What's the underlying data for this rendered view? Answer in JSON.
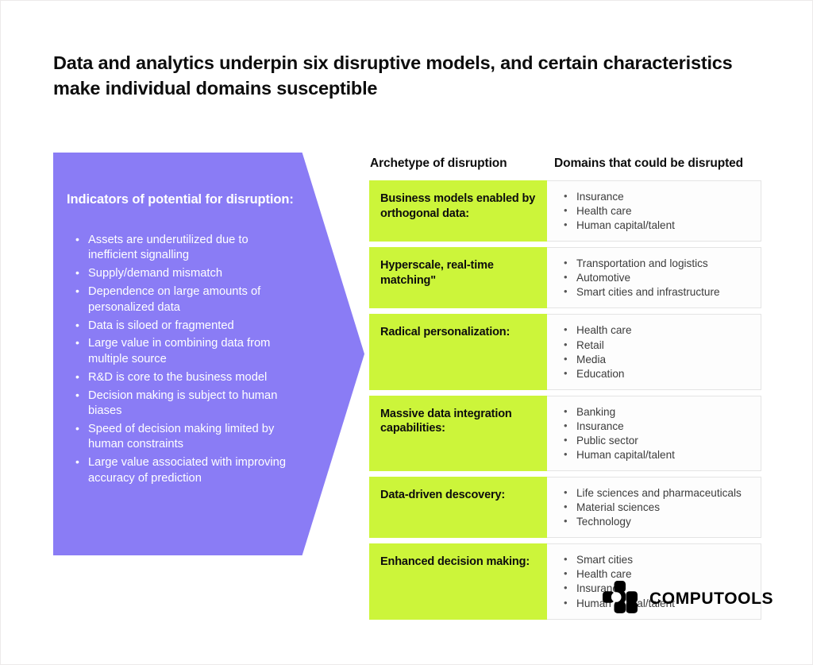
{
  "slide": {
    "title": "Data and analytics underpin six disruptive models, and certain characteristics make individual domains susceptible",
    "colors": {
      "purple": "#8a7cf5",
      "green": "#ccf53a",
      "text_dark": "#0d0d0d",
      "text_gray": "#3c3c3c",
      "cell_bg": "#fdfdfd",
      "cell_border": "#e4e4e4"
    }
  },
  "arrow_panel": {
    "heading": "Indicators of potential for disruption:",
    "bullets": [
      "Assets are underutilized due to inefficient signalling",
      "Supply/demand mismatch",
      "Dependence on large amounts of personalized data",
      "Data is siloed or fragmented",
      "Large value in combining data from multiple source",
      "R&D is core to the business model",
      "Decision making is subject to human biases",
      "Speed of decision making limited by human constraints",
      "Large value associated with improving accuracy of prediction"
    ]
  },
  "table": {
    "headers": {
      "archetype": "Archetype of disruption",
      "domains": "Domains that could be disrupted"
    },
    "rows": [
      {
        "archetype": "Business models enabled by orthogonal data:",
        "domains": [
          "Insurance",
          "Health care",
          "Human capital/talent"
        ]
      },
      {
        "archetype": "Hyperscale, real-time matching\"",
        "domains": [
          "Transportation and logistics",
          "Automotive",
          "Smart cities and infrastructure"
        ]
      },
      {
        "archetype": "Radical personalization:",
        "domains": [
          "Health care",
          "Retail",
          "Media",
          "Education"
        ]
      },
      {
        "archetype": "Massive data integration capabilities:",
        "domains": [
          "Banking",
          "Insurance",
          "Public sector",
          "Human capital/talent"
        ]
      },
      {
        "archetype": "Data-driven descovery:",
        "domains": [
          "Life sciences and pharmaceuticals",
          "Material sciences",
          "Technology"
        ]
      },
      {
        "archetype": "Enhanced decision making:",
        "domains": [
          "Smart cities",
          "Health care",
          "Insurance",
          "Human capital/talent"
        ]
      }
    ]
  },
  "logo": {
    "mark": "computools-blocks-icon",
    "text": "COMPUTOOLS"
  }
}
